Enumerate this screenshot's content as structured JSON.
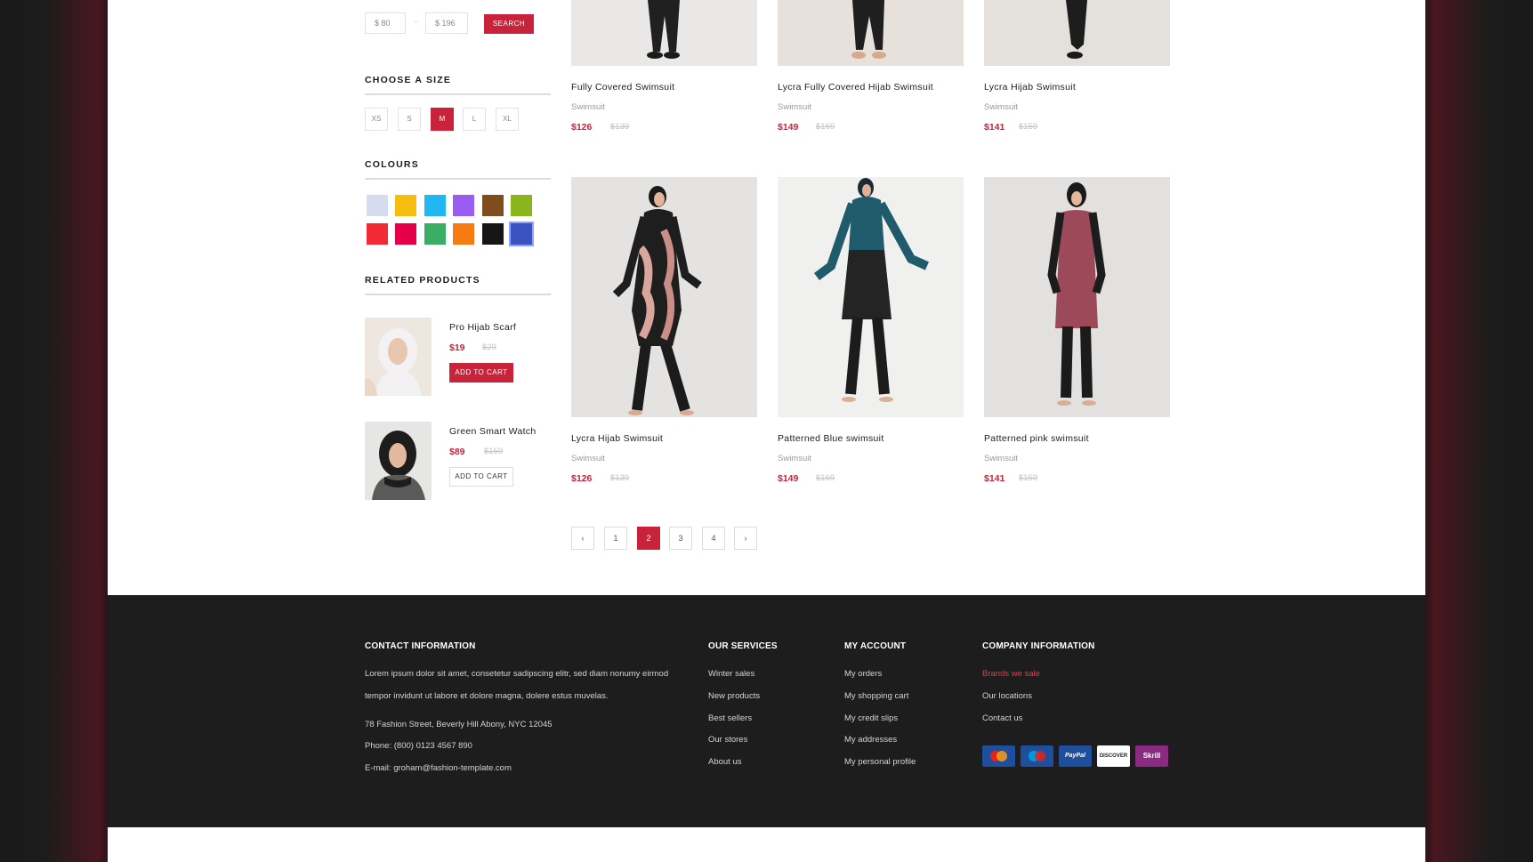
{
  "filter": {
    "price_min": "$  80",
    "price_max": "$  196",
    "search_label": "SEARCH",
    "size_heading": "CHOOSE A SIZE",
    "sizes": [
      "XS",
      "S",
      "M",
      "L",
      "XL"
    ],
    "active_size": "M",
    "colours_heading": "COLOURS",
    "colours": [
      "#d5dcf0",
      "#f6bd11",
      "#22b6f2",
      "#9b5cf1",
      "#7f4c1e",
      "#8ab51c",
      "#f22a35",
      "#e6004a",
      "#3aaf63",
      "#f57a12",
      "#161616",
      "#3b53bf"
    ],
    "active_colour": "#3b53bf"
  },
  "related": {
    "heading": "RELATED PRODUCTS",
    "items": [
      {
        "name": "Pro Hijab Scarf",
        "price": "$19",
        "old_price": "$29",
        "button": "ADD TO CART"
      },
      {
        "name": "Green Smart Watch",
        "price": "$89",
        "old_price": "$159",
        "button": "ADD TO CART"
      }
    ]
  },
  "products": [
    {
      "name": "Fully Covered Swimsuit",
      "category": "Swimsuit",
      "price": "$126",
      "old_price": "$139"
    },
    {
      "name": "Lycra Fully Covered Hijab Swimsuit",
      "category": "Swimsuit",
      "price": "$149",
      "old_price": "$169"
    },
    {
      "name": "Lycra Hijab Swimsuit",
      "category": "Swimsuit",
      "price": "$141",
      "old_price": "$159"
    },
    {
      "name": "Lycra Hijab Swimsuit",
      "category": "Swimsuit",
      "price": "$126",
      "old_price": "$139"
    },
    {
      "name": "Patterned Blue swimsuit",
      "category": "Swimsuit",
      "price": "$149",
      "old_price": "$169"
    },
    {
      "name": "Patterned pink swimsuit",
      "category": "Swimsuit",
      "price": "$141",
      "old_price": "$159"
    }
  ],
  "pagination": {
    "prev_icon": "chevron-left-icon",
    "pages": [
      "1",
      "2",
      "3",
      "4"
    ],
    "current": "2",
    "next_icon": "chevron-right-icon"
  },
  "footer": {
    "contact": {
      "heading": "CONTACT INFORMATION",
      "text_line1": "Lorem ipsum dolor sit amet, consetetur sadipscing elitr, sed diam nonumy eirmod",
      "text_line2": "tempor invidunt ut labore et dolore magna, dolere estus muvelas.",
      "address": "78 Fashion Street, Beverly Hill Abony, NYC 12045",
      "phone": "Phone: (800) 0123 4567 890",
      "email": "E-mail:  groham@fashion-template.com"
    },
    "services": {
      "heading": "OUR SERVICES",
      "links": [
        "Winter sales",
        "New products",
        "Best sellers",
        "Our stores",
        "About us"
      ]
    },
    "account": {
      "heading": "MY ACCOUNT",
      "links": [
        "My orders",
        "My shopping cart",
        "My credit slips",
        "My addresses",
        "My personal profile"
      ]
    },
    "company": {
      "heading": "COMPANY INFORMATION",
      "links": [
        "Brands we sale",
        "Our locations",
        "Contact us"
      ],
      "highlight_color": "#e7394c"
    },
    "payments": [
      {
        "name": "MasterCard",
        "color": "#1f4f9c"
      },
      {
        "name": "Maestro",
        "color": "#1f4f9c"
      },
      {
        "name": "PayPal",
        "color": "#1f4f9c"
      },
      {
        "name": "DISCOVER",
        "color": "#ffffff"
      },
      {
        "name": "Skrill",
        "color": "#8a2a80"
      }
    ]
  },
  "accent_color": "#c8233a"
}
